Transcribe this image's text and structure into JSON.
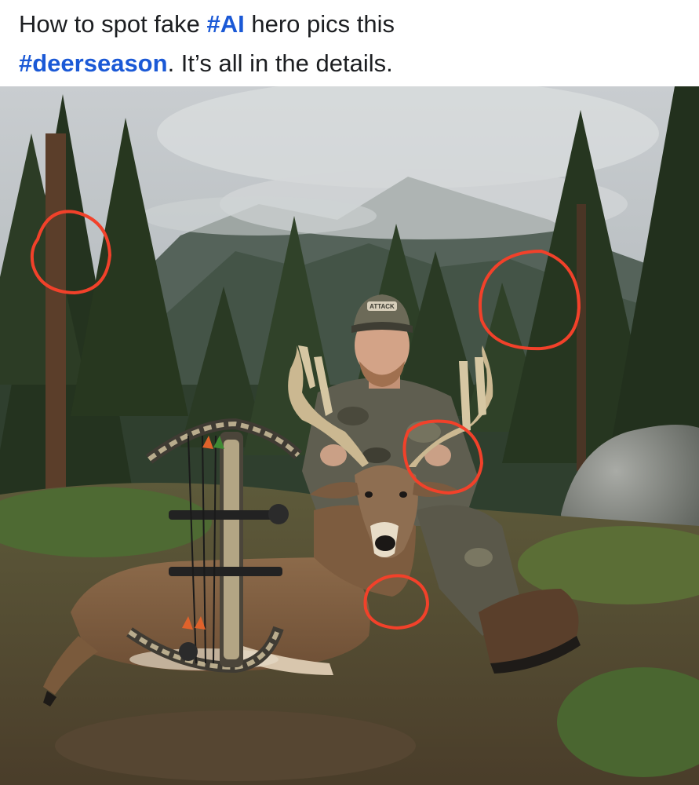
{
  "post": {
    "caption_part1": "How to spot fake ",
    "hashtag1": "#AI",
    "caption_part2": " hero pics this",
    "hashtag2": "#deerseason",
    "caption_part3": ". It’s all in the details."
  },
  "photo": {
    "logo_text": "ATTACK",
    "annotation_color": "#f2412a",
    "annotations": [
      "circle-upper-left-tree",
      "circle-right-tree",
      "circle-antler-hand",
      "circle-deer-neck"
    ]
  },
  "colors": {
    "hashtag": "#1b59d6",
    "text": "#1c1e21"
  }
}
